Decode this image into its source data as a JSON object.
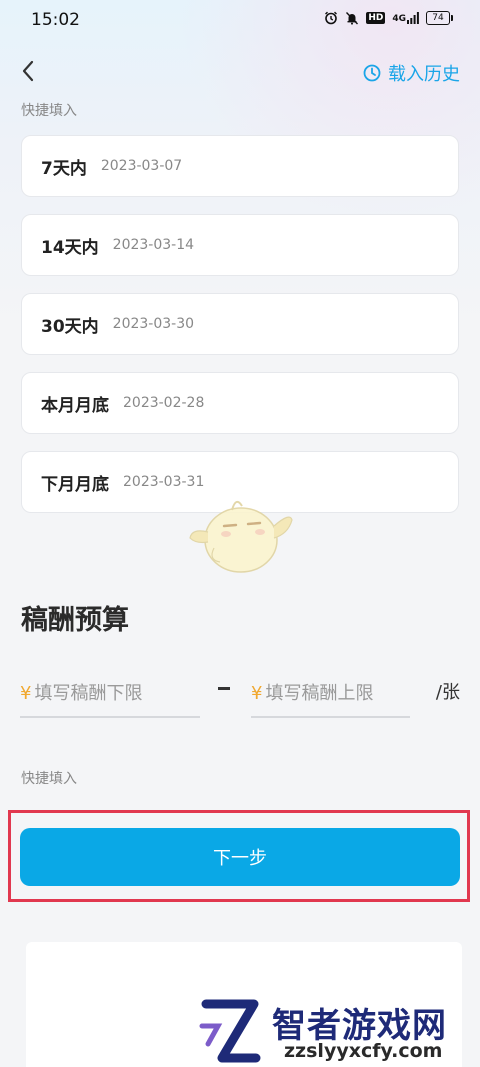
{
  "status_bar": {
    "time": "15:02",
    "hd": "HD",
    "network": "4G",
    "battery": "74"
  },
  "header": {
    "back_icon": "chevron-left-icon",
    "history_label": "载入历史",
    "history_icon": "clock-icon"
  },
  "deadline_quick_fill": {
    "label": "快捷填入",
    "options": [
      {
        "label": "7天内",
        "date": "2023-03-07"
      },
      {
        "label": "14天内",
        "date": "2023-03-14"
      },
      {
        "label": "30天内",
        "date": "2023-03-30"
      },
      {
        "label": "本月月底",
        "date": "2023-02-28"
      },
      {
        "label": "下月月底",
        "date": "2023-03-31"
      }
    ]
  },
  "budget": {
    "title": "稿酬预算",
    "currency_symbol": "¥",
    "min_placeholder": "填写稿酬下限",
    "min_value": "",
    "max_placeholder": "填写稿酬上限",
    "max_value": "",
    "unit": "/张",
    "quick_fill_label": "快捷填入"
  },
  "actions": {
    "next_label": "下一步"
  },
  "watermark": {
    "title": "智者游戏网",
    "url": "zzslyyxcfy.com"
  },
  "colors": {
    "accent": "#0aa8e6",
    "history_link": "#1aa5e8",
    "currency": "#f0a830",
    "highlight_border": "#e1384f",
    "watermark": "#1e2a78"
  }
}
